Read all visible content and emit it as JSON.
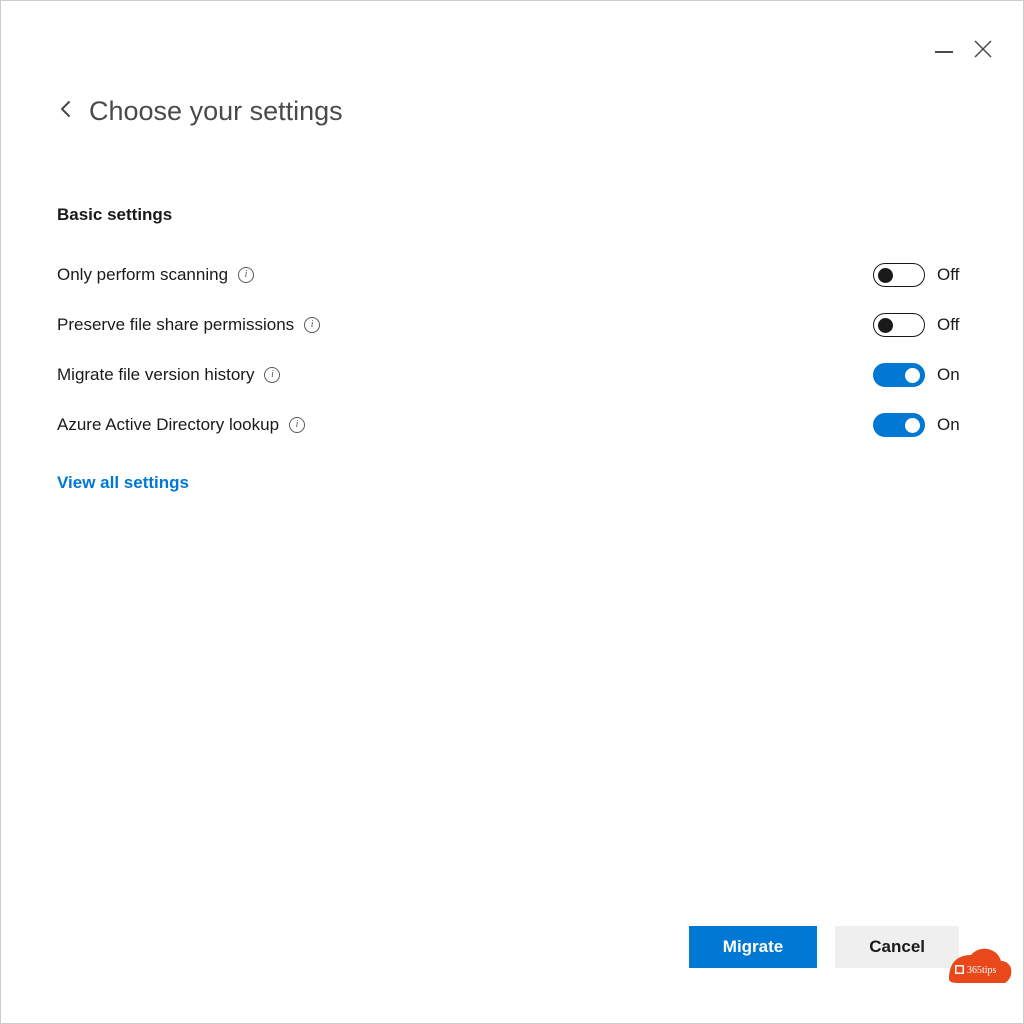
{
  "header": {
    "title": "Choose your settings"
  },
  "section": {
    "basic_heading": "Basic settings"
  },
  "settings": [
    {
      "label": "Only perform scanning",
      "on": false,
      "status": "Off"
    },
    {
      "label": "Preserve file share permissions",
      "on": false,
      "status": "Off"
    },
    {
      "label": "Migrate file version history",
      "on": true,
      "status": "On"
    },
    {
      "label": "Azure Active Directory lookup",
      "on": true,
      "status": "On"
    }
  ],
  "links": {
    "view_all": "View all settings"
  },
  "buttons": {
    "primary": "Migrate",
    "secondary": "Cancel"
  },
  "watermark": {
    "text": "365tips"
  },
  "colors": {
    "accent": "#0078d4",
    "watermark": "#e8481a"
  }
}
